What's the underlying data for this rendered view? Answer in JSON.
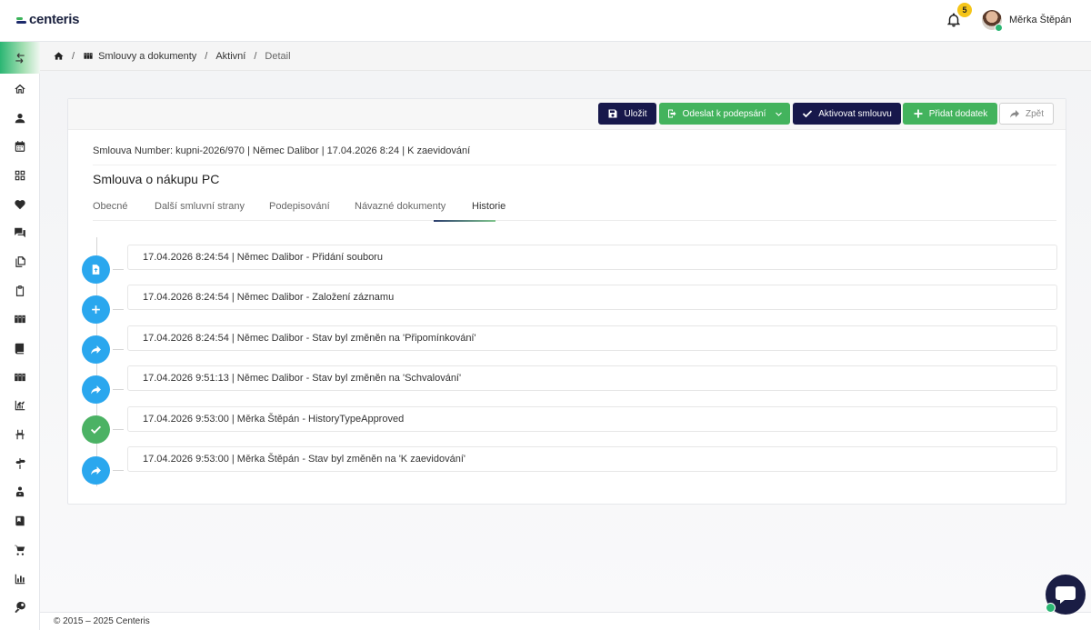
{
  "app": {
    "logo_text": "centeris",
    "notifications_count": "5",
    "user_name": "Měrka Štěpán"
  },
  "sidebar": {
    "icons": [
      "home-icon",
      "user-icon",
      "calendar-icon",
      "grid-icon",
      "heart-icon",
      "chat-bubbles-icon",
      "copy-icon",
      "clipboard-icon",
      "binders-icon",
      "book-icon",
      "binders-icon",
      "trend-chart-icon",
      "desk-icon",
      "signpost-icon",
      "person-upload-icon",
      "ledger-icon",
      "cart-icon",
      "bar-chart-icon",
      "key-icon"
    ]
  },
  "breadcrumb": {
    "items": [
      "Smlouvy a dokumenty",
      "Aktivní",
      "Detail"
    ]
  },
  "toolbar": {
    "save": "Uložit",
    "send": "Odeslat k podepsání",
    "activate": "Aktivovat smlouvu",
    "add": "Přidat dodatek",
    "back": "Zpět"
  },
  "contract": {
    "meta": "Smlouva Number: kupni-2026/970 | Němec Dalibor | 17.04.2026 8:24 | K zaevidování",
    "title": "Smlouva o nákupu PC"
  },
  "tabs": [
    "Obecné",
    "Další smluvní strany",
    "Podepisování",
    "Návazné dokumenty",
    "Historie"
  ],
  "active_tab": "Historie",
  "history": [
    {
      "text": "17.04.2026 8:24:54 | Němec Dalibor - Přidání souboru",
      "icon": "file-upload-icon",
      "color": "#2aa7ee"
    },
    {
      "text": "17.04.2026 8:24:54 | Němec Dalibor - Založení záznamu",
      "icon": "plus-icon",
      "color": "#2aa7ee"
    },
    {
      "text": "17.04.2026 8:24:54 | Němec Dalibor - Stav byl změněn na 'Připomínkování'",
      "icon": "share-arrow-icon",
      "color": "#2aa7ee"
    },
    {
      "text": "17.04.2026 9:51:13 | Němec Dalibor - Stav byl změněn na 'Schvalování'",
      "icon": "share-arrow-icon",
      "color": "#2aa7ee"
    },
    {
      "text": "17.04.2026 9:53:00 | Měrka Štěpán - HistoryTypeApproved",
      "icon": "check-icon",
      "color": "#4bb264"
    },
    {
      "text": "17.04.2026 9:53:00 | Měrka Štěpán - Stav byl změněn na 'K zaevidování'",
      "icon": "share-arrow-icon",
      "color": "#2aa7ee"
    }
  ],
  "footer": "© 2015 – 2025 Centeris",
  "colors": {
    "navy": "#17184b",
    "green": "#43b35d",
    "blue": "#2aa7ee"
  }
}
